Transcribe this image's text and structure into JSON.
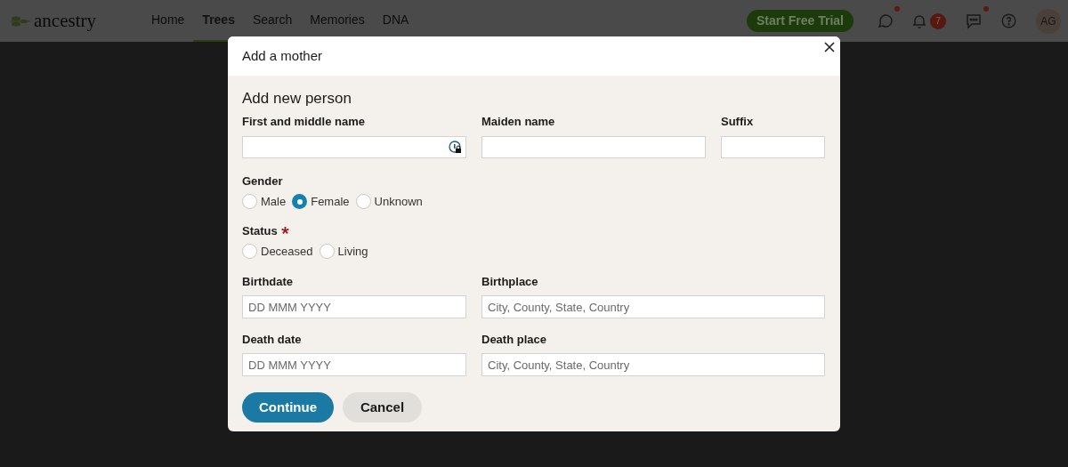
{
  "header": {
    "logo": "ancestry",
    "nav": [
      {
        "label": "Home",
        "selected": false
      },
      {
        "label": "Trees",
        "selected": true
      },
      {
        "label": "Search",
        "selected": false
      },
      {
        "label": "Memories",
        "selected": false
      },
      {
        "label": "DNA",
        "selected": false
      }
    ],
    "cta": "Start Free Trial",
    "notification_count": "7",
    "avatar": "AG"
  },
  "dialog": {
    "title": "Add a mother",
    "section_title": "Add new person",
    "name_fields": [
      {
        "label": "First and middle name",
        "kind": "lock"
      },
      {
        "label": "Maiden name",
        "kind": "plain"
      },
      {
        "label": "Suffix",
        "kind": "plain"
      }
    ],
    "radio_groups": [
      {
        "label": "Gender",
        "required": false,
        "options": [
          {
            "label": "Male",
            "selected": false
          },
          {
            "label": "Female",
            "selected": true
          },
          {
            "label": "Unknown",
            "selected": false
          }
        ]
      },
      {
        "label": "Status",
        "required": true,
        "options": [
          {
            "label": "Deceased",
            "selected": false
          },
          {
            "label": "Living",
            "selected": false
          }
        ]
      }
    ],
    "event_rows": [
      {
        "date_label": "Birthdate",
        "date_placeholder": "DD MMM YYYY",
        "place_label": "Birthplace",
        "place_placeholder": "City, County, State, Country"
      },
      {
        "date_label": "Death date",
        "date_placeholder": "DD MMM YYYY",
        "place_label": "Death place",
        "place_placeholder": "City, County, State, Country"
      }
    ],
    "buttons": [
      {
        "label": "Continue",
        "kind": "primary"
      },
      {
        "label": "Cancel",
        "kind": "secondary"
      }
    ]
  }
}
